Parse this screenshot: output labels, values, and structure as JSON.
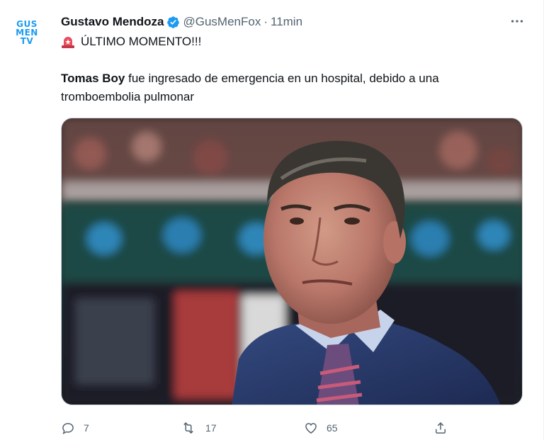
{
  "author": {
    "name": "Gustavo Mendoza",
    "handle": "@GusMenFox",
    "separator": "·",
    "time": "11min",
    "avatar_text": [
      "GUS",
      "MEN",
      "TV"
    ],
    "verified": true
  },
  "menu": {
    "icon": "more-icon",
    "label": "•••"
  },
  "tweet": {
    "headline_emoji": "police-light-icon",
    "headline": "ÚLTIMO MOMENTO!!!",
    "bold_name": "Tomas Boy",
    "text": " fue ingresado de emergencia en un hospital, debido a una tromboembolia pulmonar"
  },
  "media": {
    "type": "photo"
  },
  "actions": {
    "reply": {
      "icon": "reply-icon",
      "count": "7"
    },
    "retweet": {
      "icon": "retweet-icon",
      "count": "17"
    },
    "like": {
      "icon": "heart-icon",
      "count": "65"
    },
    "share": {
      "icon": "share-icon"
    }
  },
  "colors": {
    "accent": "#1d9bf0",
    "text": "#0f1419",
    "muted": "#536471"
  }
}
